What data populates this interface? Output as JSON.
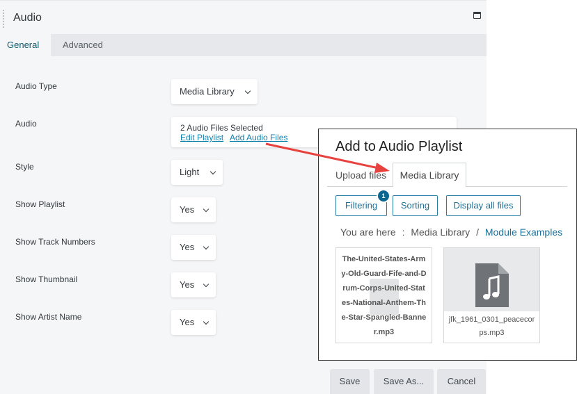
{
  "panel": {
    "title": "Audio",
    "tabs": [
      {
        "label": "General",
        "active": true
      },
      {
        "label": "Advanced",
        "active": false
      }
    ]
  },
  "fields": {
    "audio_type": {
      "label": "Audio Type",
      "value": "Media Library"
    },
    "audio": {
      "label": "Audio",
      "count_text": "2 Audio Files Selected",
      "edit_link": "Edit Playlist",
      "add_link": "Add Audio Files"
    },
    "style": {
      "label": "Style",
      "value": "Light"
    },
    "show_playlist": {
      "label": "Show Playlist",
      "value": "Yes"
    },
    "show_track_numbers": {
      "label": "Show Track Numbers",
      "value": "Yes"
    },
    "show_thumbnail": {
      "label": "Show Thumbnail",
      "value": "Yes"
    },
    "show_artist_name": {
      "label": "Show Artist Name",
      "value": "Yes"
    }
  },
  "footer": {
    "save": "Save",
    "save_as": "Save As...",
    "cancel": "Cancel"
  },
  "modal": {
    "title": "Add to Audio Playlist",
    "tabs": {
      "upload": "Upload files",
      "media": "Media Library"
    },
    "buttons": {
      "filtering": "Filtering",
      "filtering_badge": "1",
      "sorting": "Sorting",
      "display_all": "Display all files"
    },
    "breadcrumb": {
      "prefix": "You are here",
      "separator_1": ":",
      "item_1": "Media Library",
      "separator_2": "/",
      "item_2": "Module Examples"
    },
    "files": [
      {
        "name": "The-United-States-Army-Old-Guard-Fife-and-Drum-Corps-United-States-National-Anthem-The-Star-Spangled-Banner.mp3"
      },
      {
        "name": "jfk_1961_0301_peacecorps.mp3",
        "icon": "audio-file-icon"
      }
    ]
  },
  "colors": {
    "accent": "#0e7fae",
    "annotation_arrow": "#e8423f"
  }
}
